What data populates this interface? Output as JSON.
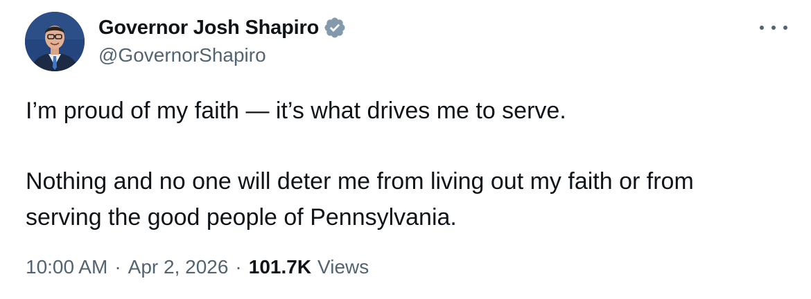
{
  "tweet": {
    "author": {
      "display_name": "Governor Josh Shapiro",
      "handle": "@GovernorShapiro",
      "verified": true,
      "verified_badge_color": "#829aab"
    },
    "more_icon": "more-options-icon",
    "text": {
      "paragraph1_line1": "I’m proud of my faith — it’s what drives me to serve.",
      "paragraph2_line1": "Nothing and no one will deter me from living out my faith or from",
      "paragraph2_line2": "serving the good people of Pennsylvania."
    },
    "meta": {
      "time": "10:00 AM",
      "separator": "·",
      "date": "Apr 2, 2026",
      "views_count": "101.7K",
      "views_label": "Views"
    }
  }
}
